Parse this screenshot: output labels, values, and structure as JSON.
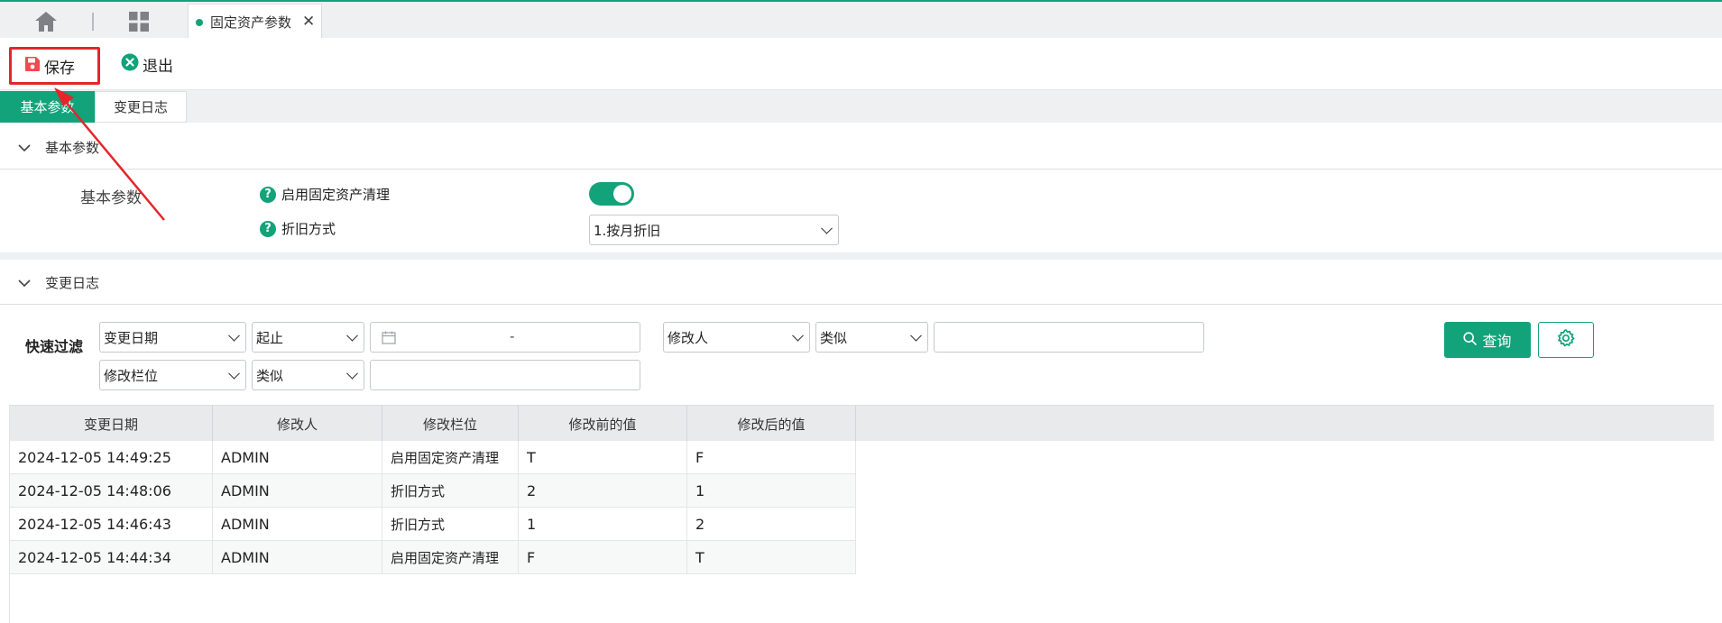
{
  "topbar": {
    "open_tab": "固定资产参数",
    "close_glyph": "✕"
  },
  "toolbar": {
    "save_label": "保存",
    "exit_label": "退出"
  },
  "subtabs": [
    "基本参数",
    "变更日志"
  ],
  "basic_section": {
    "title": "基本参数",
    "group_label": "基本参数",
    "params": [
      {
        "label": "启用固定资产清理",
        "control": "toggle",
        "value": true
      },
      {
        "label": "折旧方式",
        "control": "select",
        "value": "1.按月折旧"
      }
    ]
  },
  "log_section": {
    "title": "变更日志"
  },
  "filter": {
    "label": "快速过滤",
    "row1": {
      "field1": "变更日期",
      "op1": "起止",
      "date_separator": "-",
      "field2": "修改人",
      "op2": "类似",
      "value2": ""
    },
    "row2": {
      "field": "修改栏位",
      "op": "类似",
      "value": ""
    },
    "query_label": "查询"
  },
  "table": {
    "columns": [
      "变更日期",
      "修改人",
      "修改栏位",
      "修改前的值",
      "修改后的值"
    ],
    "rows": [
      [
        "2024-12-05 14:49:25",
        "ADMIN",
        "启用固定资产清理",
        "T",
        "F"
      ],
      [
        "2024-12-05 14:48:06",
        "ADMIN",
        "折旧方式",
        "2",
        "1"
      ],
      [
        "2024-12-05 14:46:43",
        "ADMIN",
        "折旧方式",
        "1",
        "2"
      ],
      [
        "2024-12-05 14:44:34",
        "ADMIN",
        "启用固定资产清理",
        "F",
        "T"
      ]
    ]
  },
  "colors": {
    "accent": "#12a37a",
    "highlight": "#e5252a",
    "save_icon": "#f04a4f"
  },
  "icons": {
    "home": "home-icon",
    "apps": "grid-icon",
    "save": "floppy-icon",
    "exit": "close-circle-icon",
    "help": "question-icon",
    "collapse": "chevron-down-icon",
    "date": "calendar-icon",
    "query": "search-icon",
    "settings": "gear-icon"
  }
}
